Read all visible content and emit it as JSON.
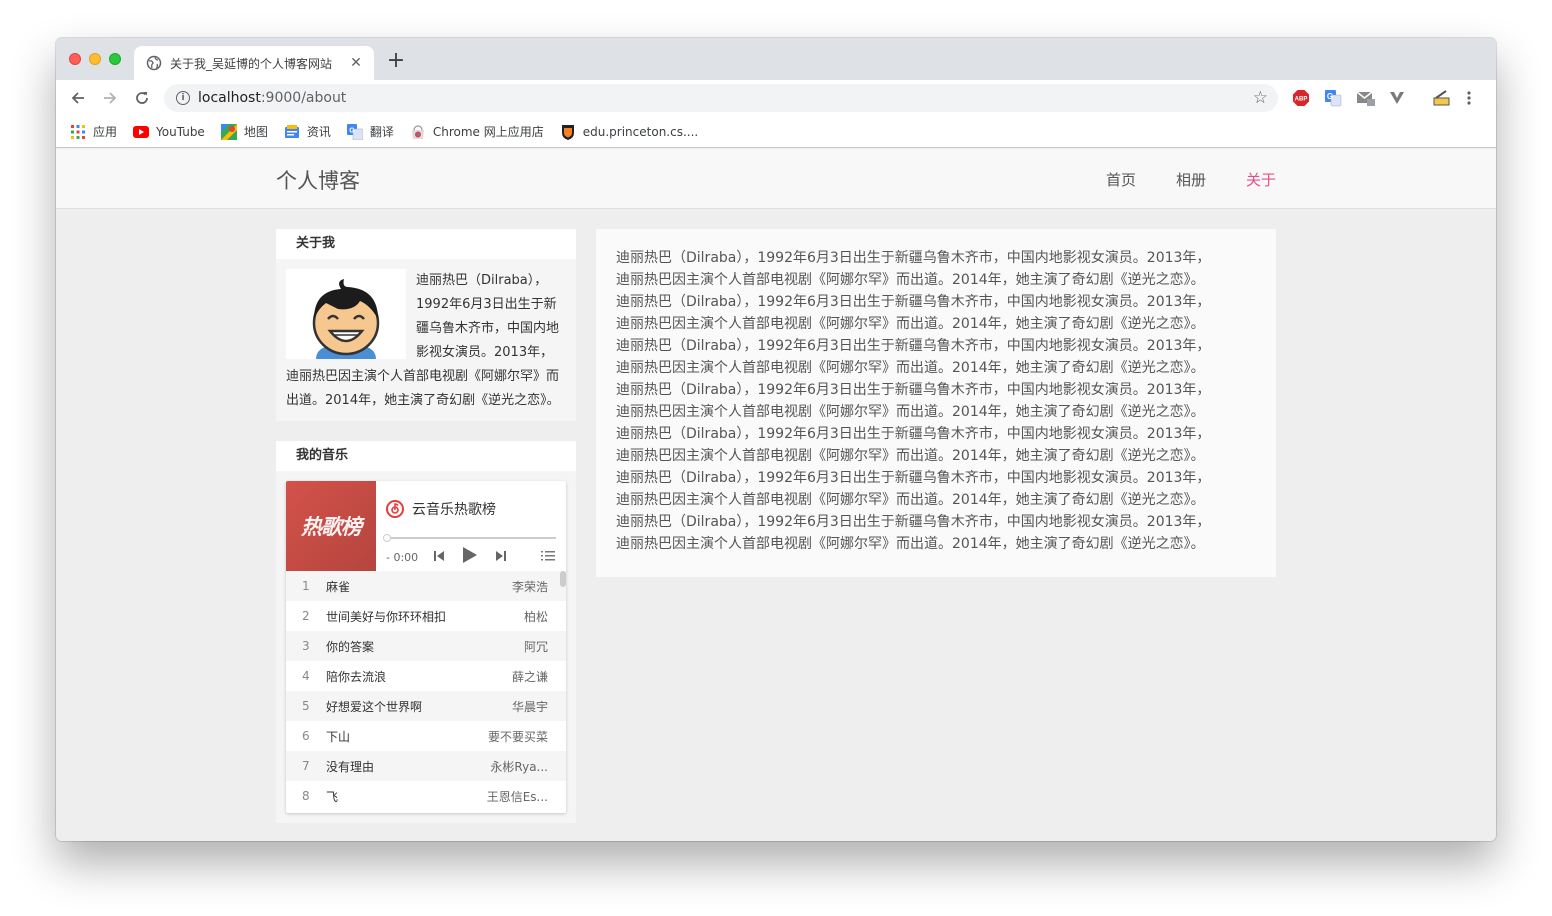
{
  "browser": {
    "tab_title": "关于我_吴延博的个人博客网站",
    "new_tab": "+",
    "url_host": "localhost",
    "url_path": ":9000/about",
    "bookmarks": [
      {
        "label": "应用",
        "icon": "apps-icon"
      },
      {
        "label": "YouTube",
        "icon": "youtube-icon"
      },
      {
        "label": "地图",
        "icon": "maps-icon"
      },
      {
        "label": "资讯",
        "icon": "news-icon"
      },
      {
        "label": "翻译",
        "icon": "translate-icon"
      },
      {
        "label": "Chrome 网上应用店",
        "icon": "webstore-icon"
      },
      {
        "label": "edu.princeton.cs....",
        "icon": "princeton-icon"
      }
    ],
    "extensions": [
      "abp-icon",
      "translate-ext-icon",
      "gmail-icon",
      "vimium-icon",
      "tools-icon",
      "menu-icon"
    ],
    "abp_label": "ABP"
  },
  "site": {
    "brand": "个人博客",
    "nav": [
      {
        "label": "首页",
        "active": false
      },
      {
        "label": "相册",
        "active": false
      },
      {
        "label": "关于",
        "active": true
      }
    ],
    "accent_color": "#e6508a"
  },
  "about_panel": {
    "title": "关于我",
    "text": "迪丽热巴（Dilraba），1992年6月3日出生于新疆乌鲁木齐市，中国内地影视女演员。2013年，迪丽热巴因主演个人首部电视剧《阿娜尔罕》而出道。2014年，她主演了奇幻剧《逆光之恋》。"
  },
  "music_panel": {
    "title": "我的音乐",
    "cover_text": "热歌榜",
    "playlist_title": "云音乐热歌榜",
    "time": "- 0:00",
    "songs": [
      {
        "num": "1",
        "name": "麻雀",
        "artist": "李荣浩"
      },
      {
        "num": "2",
        "name": "世间美好与你环环相扣",
        "artist": "柏松"
      },
      {
        "num": "3",
        "name": "你的答案",
        "artist": "阿冗"
      },
      {
        "num": "4",
        "name": "陪你去流浪",
        "artist": "薛之谦"
      },
      {
        "num": "5",
        "name": "好想爱这个世界啊",
        "artist": "华晨宇"
      },
      {
        "num": "6",
        "name": "下山",
        "artist": "要不要买菜"
      },
      {
        "num": "7",
        "name": "没有理由",
        "artist": "永彬Rya..."
      },
      {
        "num": "8",
        "name": "飞",
        "artist": "王恩信Es..."
      }
    ]
  },
  "main_content": {
    "lines": [
      "迪丽热巴（Dilraba），1992年6月3日出生于新疆乌鲁木齐市，中国内地影视女演员。2013年，",
      "迪丽热巴因主演个人首部电视剧《阿娜尔罕》而出道。2014年，她主演了奇幻剧《逆光之恋》。",
      "迪丽热巴（Dilraba），1992年6月3日出生于新疆乌鲁木齐市，中国内地影视女演员。2013年，",
      "迪丽热巴因主演个人首部电视剧《阿娜尔罕》而出道。2014年，她主演了奇幻剧《逆光之恋》。",
      "迪丽热巴（Dilraba），1992年6月3日出生于新疆乌鲁木齐市，中国内地影视女演员。2013年，",
      "迪丽热巴因主演个人首部电视剧《阿娜尔罕》而出道。2014年，她主演了奇幻剧《逆光之恋》。",
      "迪丽热巴（Dilraba），1992年6月3日出生于新疆乌鲁木齐市，中国内地影视女演员。2013年，",
      "迪丽热巴因主演个人首部电视剧《阿娜尔罕》而出道。2014年，她主演了奇幻剧《逆光之恋》。",
      "迪丽热巴（Dilraba），1992年6月3日出生于新疆乌鲁木齐市，中国内地影视女演员。2013年，",
      "迪丽热巴因主演个人首部电视剧《阿娜尔罕》而出道。2014年，她主演了奇幻剧《逆光之恋》。",
      "迪丽热巴（Dilraba），1992年6月3日出生于新疆乌鲁木齐市，中国内地影视女演员。2013年，",
      "迪丽热巴因主演个人首部电视剧《阿娜尔罕》而出道。2014年，她主演了奇幻剧《逆光之恋》。",
      "迪丽热巴（Dilraba），1992年6月3日出生于新疆乌鲁木齐市，中国内地影视女演员。2013年，",
      "迪丽热巴因主演个人首部电视剧《阿娜尔罕》而出道。2014年，她主演了奇幻剧《逆光之恋》。"
    ]
  }
}
